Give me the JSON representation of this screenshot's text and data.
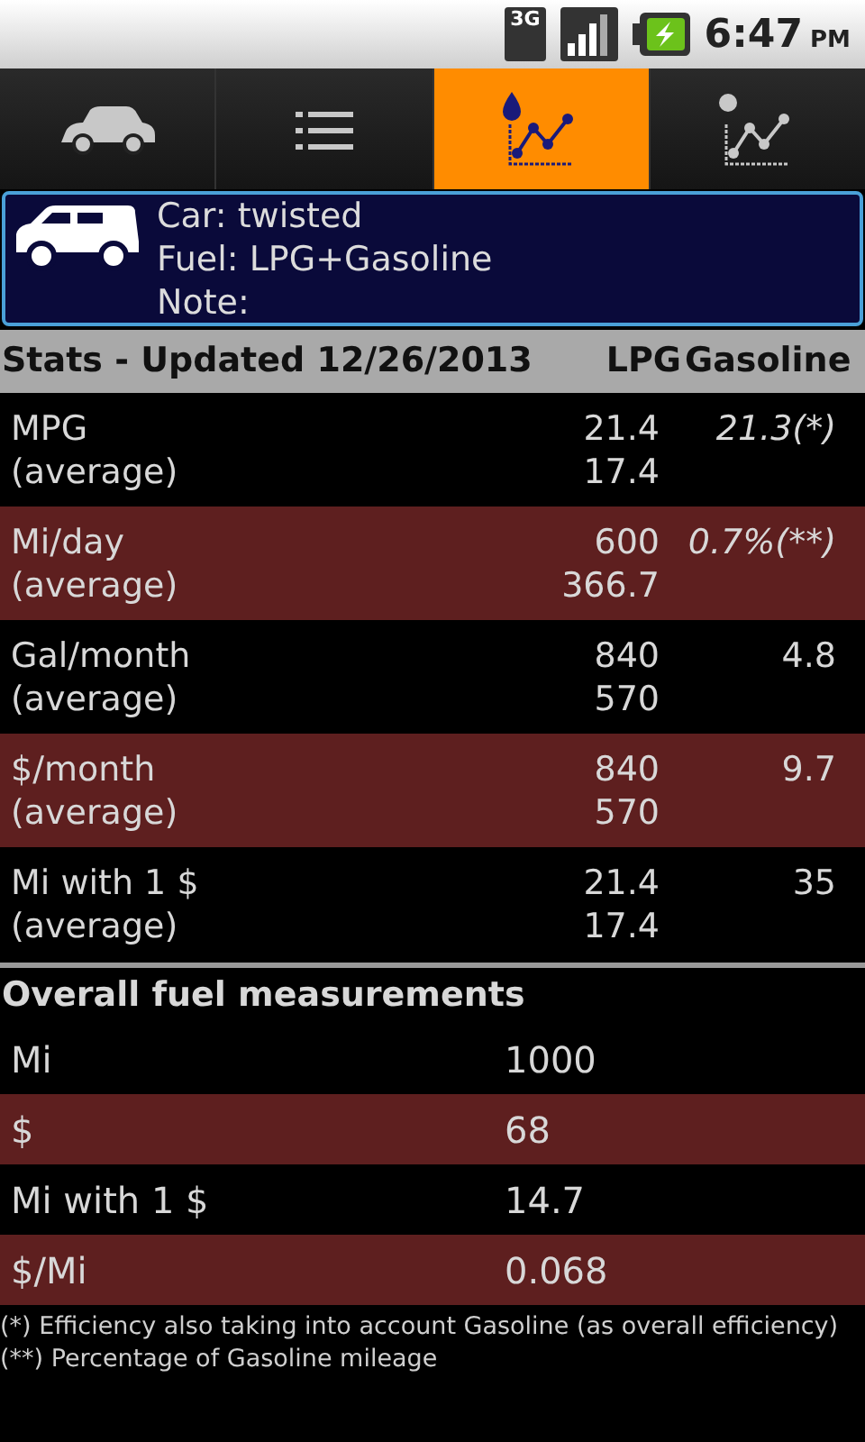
{
  "status_bar": {
    "network": "3G",
    "time": "6:47",
    "ampm": "PM"
  },
  "tabs": [
    {
      "kind": "car",
      "selected": false
    },
    {
      "kind": "list",
      "selected": false
    },
    {
      "kind": "fuel-chart",
      "selected": true
    },
    {
      "kind": "cost-chart",
      "selected": false
    }
  ],
  "car_card": {
    "lines": [
      "Car: twisted",
      "Fuel: LPG+Gasoline",
      "Note:"
    ]
  },
  "stats": {
    "title": "Stats - Updated 12/26/2013",
    "columns": [
      "LPG",
      "Gasoline"
    ],
    "rows": [
      {
        "label": "MPG",
        "sub": "(average)",
        "lpg": "21.4",
        "lpg_avg": "17.4",
        "gasoline": "21.3(*)",
        "italic": true
      },
      {
        "label": "Mi/day",
        "sub": "(average)",
        "lpg": "600",
        "lpg_avg": "366.7",
        "gasoline": "0.7%(**)",
        "italic": true
      },
      {
        "label": "Gal/month",
        "sub": "(average)",
        "lpg": "840",
        "lpg_avg": "570",
        "gasoline": "4.8",
        "italic": false
      },
      {
        "label": "$/month",
        "sub": "(average)",
        "lpg": "840",
        "lpg_avg": "570",
        "gasoline": "9.7",
        "italic": false
      },
      {
        "label": "Mi with 1 $",
        "sub": "(average)",
        "lpg": "21.4",
        "lpg_avg": "17.4",
        "gasoline": "35",
        "italic": false
      }
    ]
  },
  "overall": {
    "title": "Overall fuel measurements",
    "rows": [
      {
        "label": "Mi",
        "value": "1000"
      },
      {
        "label": "$",
        "value": "68"
      },
      {
        "label": "Mi with 1 $",
        "value": "14.7"
      },
      {
        "label": "$/Mi",
        "value": "0.068"
      }
    ]
  },
  "footnotes": [
    "(*) Efficiency also taking into account Gasoline (as overall efficiency)",
    "(**) Percentage of Gasoline mileage"
  ]
}
